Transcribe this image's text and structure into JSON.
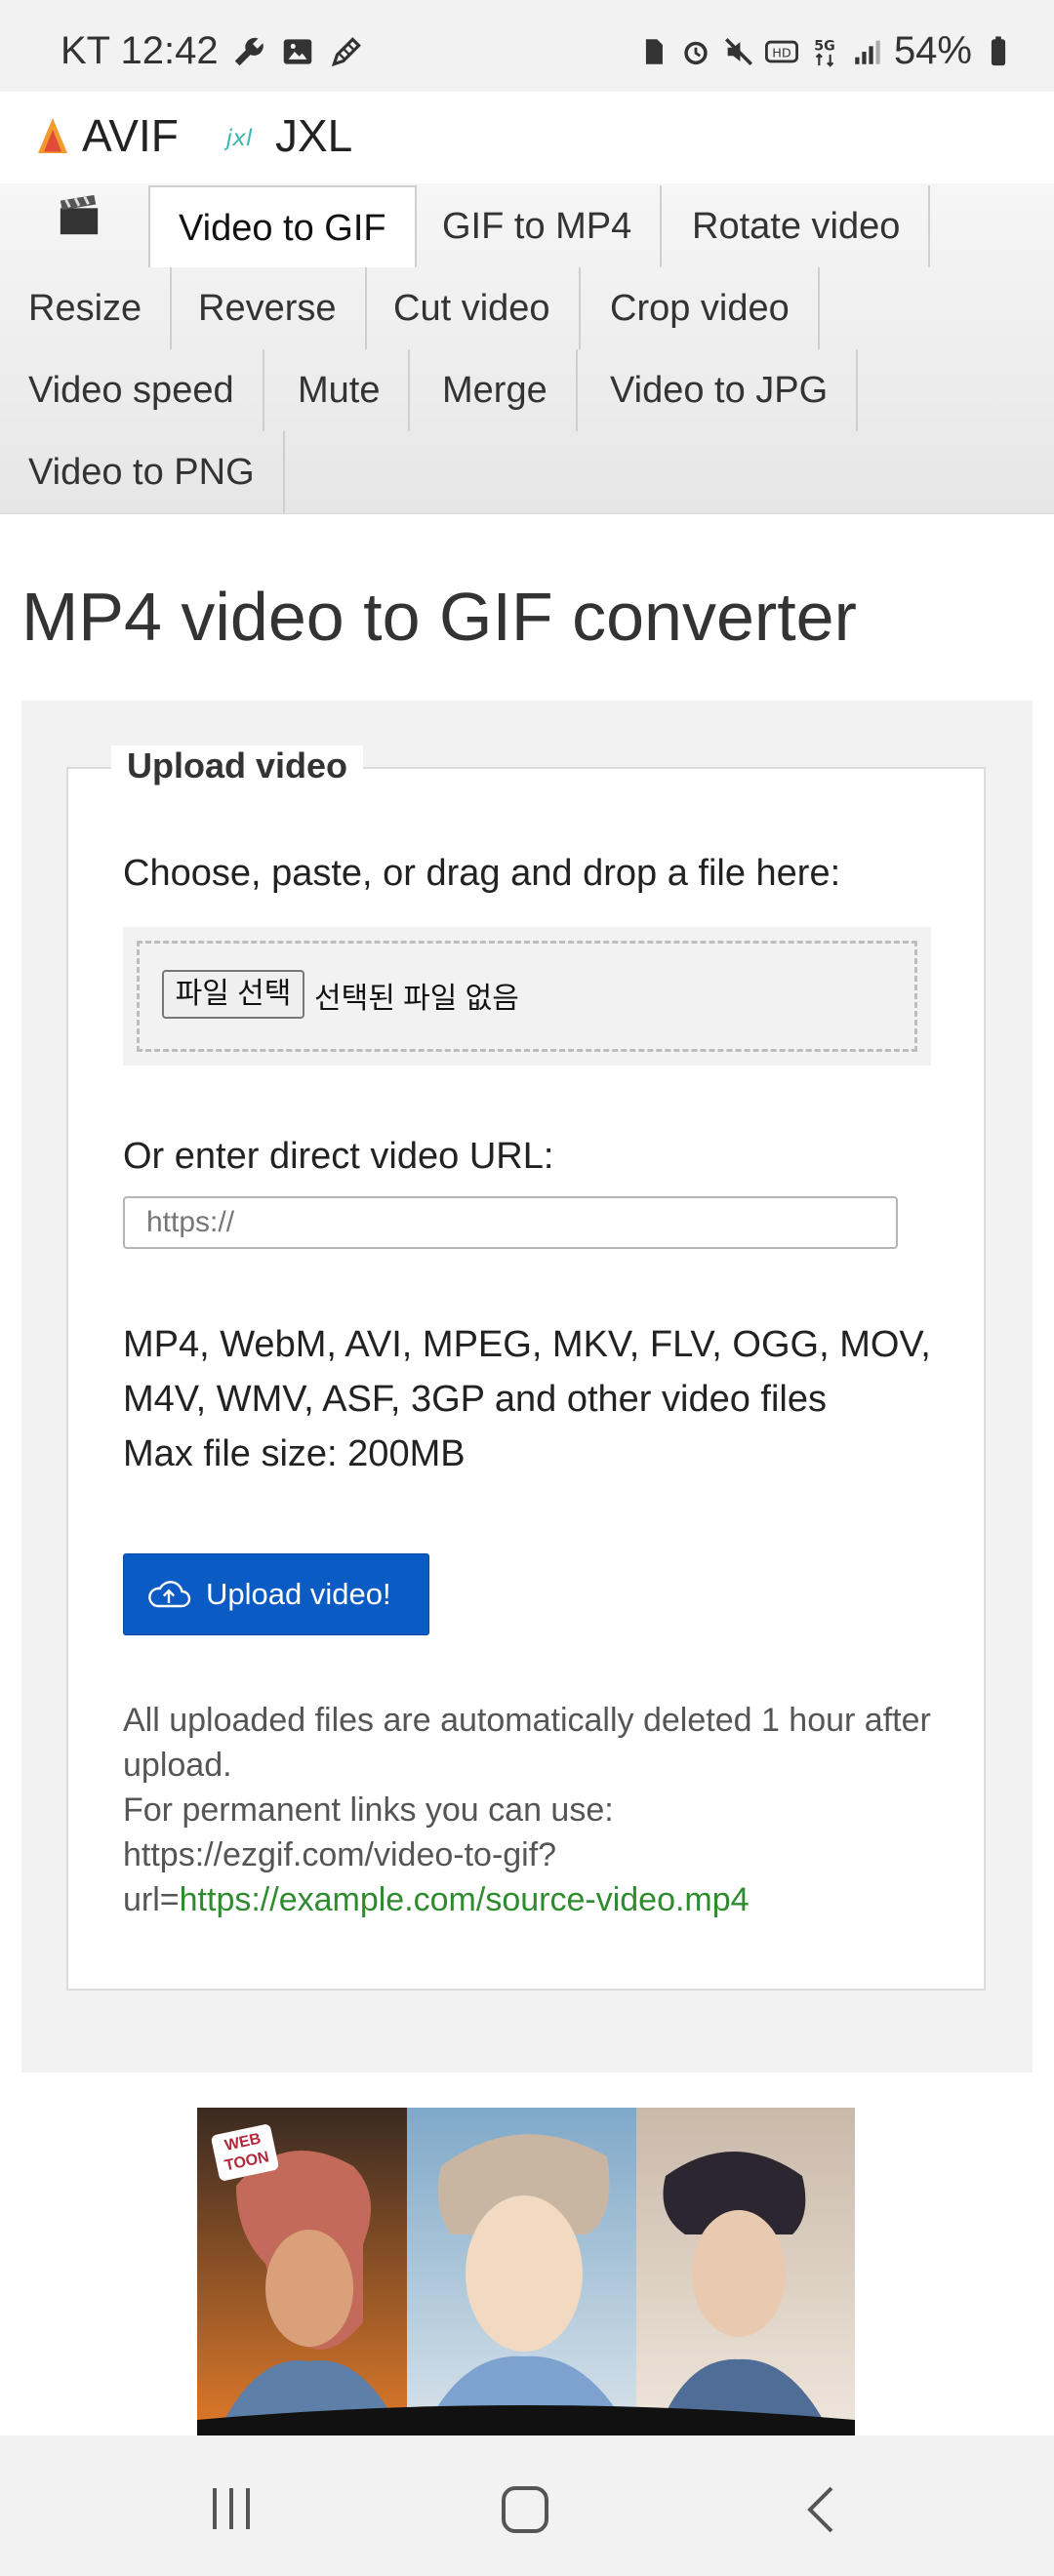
{
  "status_bar": {
    "carrier_time": "KT 12:42",
    "battery": "54%"
  },
  "format_bar": {
    "avif": "AVIF",
    "jxl": "JXL"
  },
  "nav": {
    "tabs": [
      "Video to GIF",
      "GIF to MP4",
      "Rotate video",
      "Resize",
      "Reverse",
      "Cut video",
      "Crop video",
      "Video speed",
      "Mute",
      "Merge",
      "Video to JPG",
      "Video to PNG"
    ],
    "active": "Video to GIF"
  },
  "page": {
    "title": "MP4 video to GIF converter"
  },
  "upload": {
    "legend": "Upload video",
    "choose_label": "Choose, paste, or drag and drop a file here:",
    "file_button": "파일 선택",
    "file_none": "선택된 파일 없음",
    "url_label": "Or enter direct video URL:",
    "url_placeholder": "https://",
    "formats_line1": "MP4, WebM, AVI, MPEG, MKV, FLV, OGG, MOV,",
    "formats_line2": "M4V, WMV, ASF, 3GP and other video files",
    "max_size": "Max file size: 200MB",
    "button": "Upload video!",
    "note_line1": "All uploaded files are automatically deleted 1 hour after upload.",
    "note_line2": "For permanent links you can use:",
    "note_line3": "https://ezgif.com/video-to-gif?",
    "note_prefix": "url=",
    "note_link": "https://example.com/source-video.mp4"
  },
  "ad": {
    "badge": "WEB TOON"
  },
  "colors": {
    "accent": "#0a5bc4",
    "link": "#2e8b2e"
  }
}
